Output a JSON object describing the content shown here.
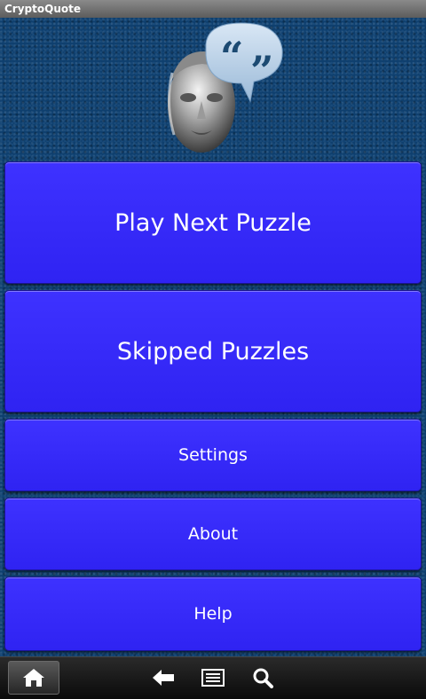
{
  "window": {
    "title": "CryptoQuote"
  },
  "menu": {
    "play_next_label": "Play Next Puzzle",
    "skipped_label": "Skipped Puzzles",
    "settings_label": "Settings",
    "about_label": "About",
    "help_label": "Help"
  },
  "colors": {
    "button_fill": "#3a2ef8",
    "background": "#0e3f6e",
    "bubble": "#bcd4ec"
  },
  "icons": {
    "logo": "chrome-head-with-quote-bubble",
    "home": "home-icon",
    "back": "back-arrow-icon",
    "menu": "menu-icon",
    "search": "search-icon"
  }
}
